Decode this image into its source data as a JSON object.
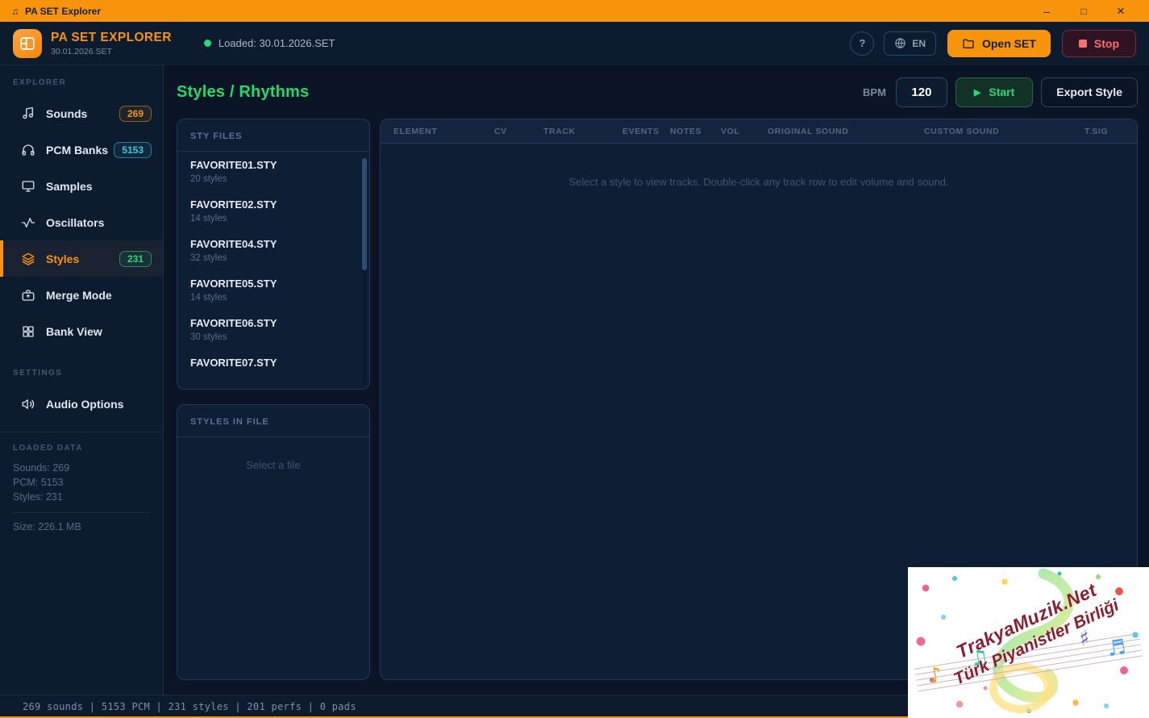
{
  "window": {
    "title": "PA SET Explorer",
    "note_icon": "♫",
    "minimize": "–",
    "maximize": "□",
    "close": "×"
  },
  "header": {
    "app_title": "PA SET EXPLORER",
    "app_subtitle": "30.01.2026.SET",
    "loaded_status": "Loaded: 30.01.2026.SET",
    "help_label": "?",
    "language_label": "EN",
    "open_set_label": "Open SET",
    "stop_label": "Stop"
  },
  "sidebar": {
    "explorer_label": "EXPLORER",
    "items": [
      {
        "label": "Sounds",
        "badge": "269"
      },
      {
        "label": "PCM Banks",
        "badge": "5153"
      },
      {
        "label": "Samples",
        "badge": ""
      },
      {
        "label": "Oscillators",
        "badge": ""
      },
      {
        "label": "Styles",
        "badge": "231"
      },
      {
        "label": "Merge Mode",
        "badge": ""
      },
      {
        "label": "Bank View",
        "badge": ""
      }
    ],
    "settings_label": "SETTINGS",
    "settings_items": [
      {
        "label": "Audio Options"
      }
    ],
    "loaded_data_label": "LOADED DATA",
    "stats": [
      "Sounds: 269",
      "PCM: 5153",
      "Styles: 231"
    ],
    "size_text": "Size: 226.1 MB"
  },
  "main": {
    "page_title": "Styles / Rhythms",
    "bpm_label": "BPM",
    "bpm_value": "120",
    "start_icon": "▶",
    "start_label": "Start",
    "export_label": "Export Style",
    "sty_files": {
      "header": "STY FILES",
      "files": [
        {
          "name": "FAVORITE01.STY",
          "count": "20 styles"
        },
        {
          "name": "FAVORITE02.STY",
          "count": "14 styles"
        },
        {
          "name": "FAVORITE04.STY",
          "count": "32 styles"
        },
        {
          "name": "FAVORITE05.STY",
          "count": "14 styles"
        },
        {
          "name": "FAVORITE06.STY",
          "count": "30 styles"
        },
        {
          "name": "FAVORITE07.STY",
          "count": ""
        }
      ]
    },
    "styles_in_file": {
      "header": "STYLES IN FILE",
      "placeholder": "Select a file"
    },
    "table": {
      "columns": [
        "ELEMENT",
        "CV",
        "TRACK",
        "EVENTS",
        "NOTES",
        "VOL",
        "ORIGINAL SOUND",
        "CUSTOM SOUND",
        "T.SIG"
      ],
      "empty_message": "Select a style to view tracks. Double-click any track row to edit volume and sound."
    }
  },
  "statusbar": {
    "text": "269 sounds | 5153 PCM | 231 styles | 201 perfs | 0 pads"
  },
  "watermark": {
    "line1": "TrakyaMuzik.Net",
    "line2": "Türk Piyanistler Birliği",
    "note1": "♪",
    "note2": "♫",
    "note3": "♯",
    "note4": "♬"
  },
  "colors": {
    "accent_orange": "#F8940B",
    "accent_green": "#2BD875",
    "accent_cyan": "#3EC7E0",
    "accent_red": "#F87171",
    "title_green": "#21DA6E",
    "app_bg": "#0A1424",
    "panel_bg": "#0E1E34",
    "panel_border": "#1E3A5C"
  }
}
